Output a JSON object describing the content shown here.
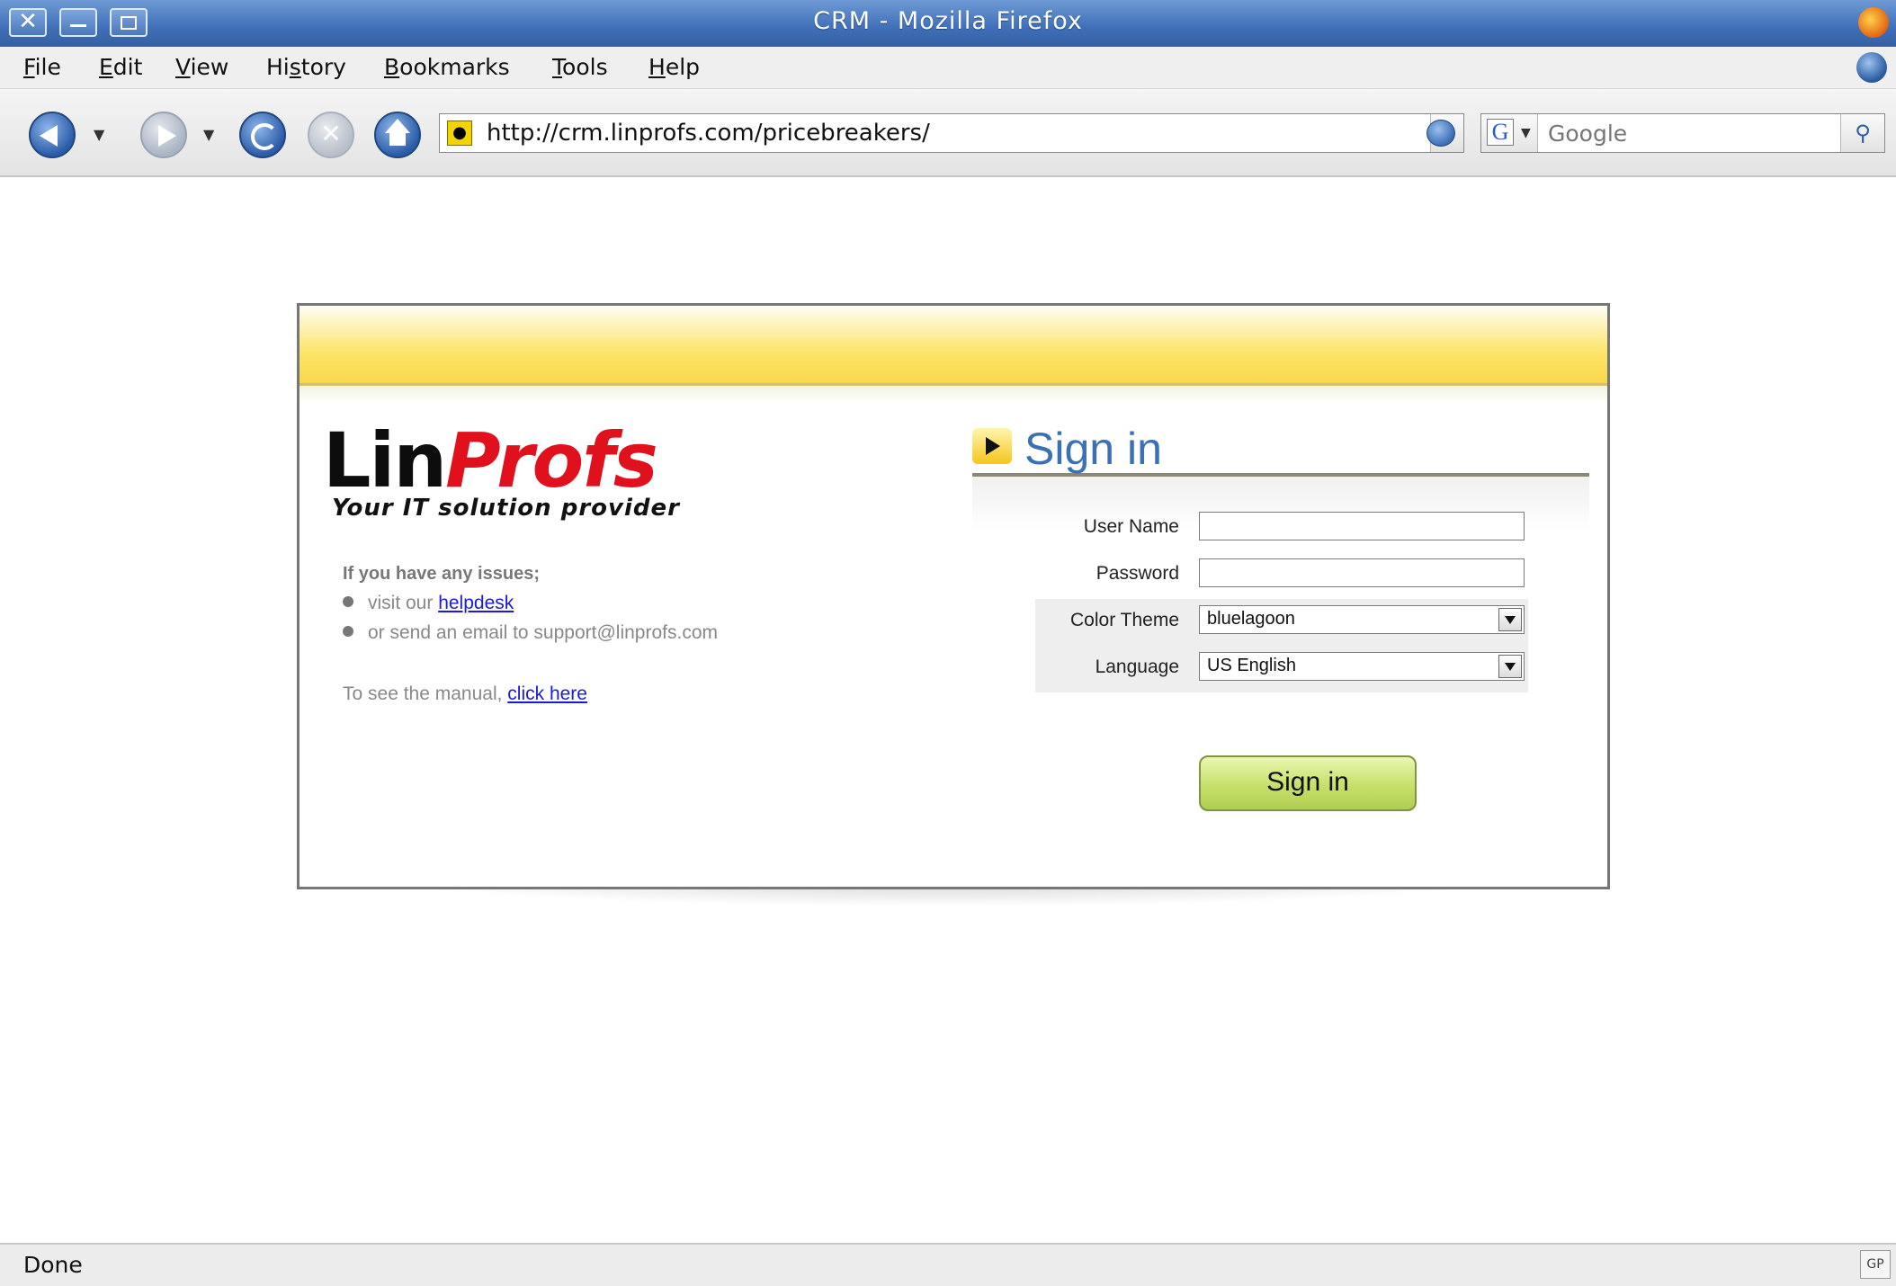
{
  "window": {
    "title": "CRM - Mozilla Firefox"
  },
  "menu": {
    "items": [
      {
        "pre": "",
        "key": "F",
        "post": "ile"
      },
      {
        "pre": "",
        "key": "E",
        "post": "dit"
      },
      {
        "pre": "",
        "key": "V",
        "post": "iew"
      },
      {
        "pre": "Hi",
        "key": "s",
        "post": "tory"
      },
      {
        "pre": "",
        "key": "B",
        "post": "ookmarks"
      },
      {
        "pre": "",
        "key": "T",
        "post": "ools"
      },
      {
        "pre": "",
        "key": "H",
        "post": "elp"
      }
    ]
  },
  "toolbar": {
    "url": "http://crm.linprofs.com/pricebreakers/",
    "search_placeholder": "Google",
    "search_engine_icon": "google-icon"
  },
  "login": {
    "logo": {
      "lin": "Lin",
      "profs": "Profs"
    },
    "tagline": "Your IT solution provider",
    "issues_title": "If you have any issues;",
    "issue_1_text": "visit our ",
    "issue_1_link": "helpdesk",
    "issue_2_text": "or send an email to support@linprofs.com",
    "manual_text": "To see the manual, ",
    "manual_link": "click here",
    "signin_title": "Sign in",
    "fields": {
      "username_label": "User Name",
      "username_value": "",
      "password_label": "Password",
      "password_value": "",
      "theme_label": "Color Theme",
      "theme_value": "bluelagoon",
      "language_label": "Language",
      "language_value": "US English"
    },
    "signin_button": "Sign in"
  },
  "status": {
    "text": "Done",
    "badge": "GP"
  },
  "colors": {
    "title_bar": "#3f6fb8",
    "header_yellow": "#fde46a",
    "signin_blue": "#3d6fb5",
    "logo_red": "#e0101c",
    "button_green": "#c6e06a"
  }
}
